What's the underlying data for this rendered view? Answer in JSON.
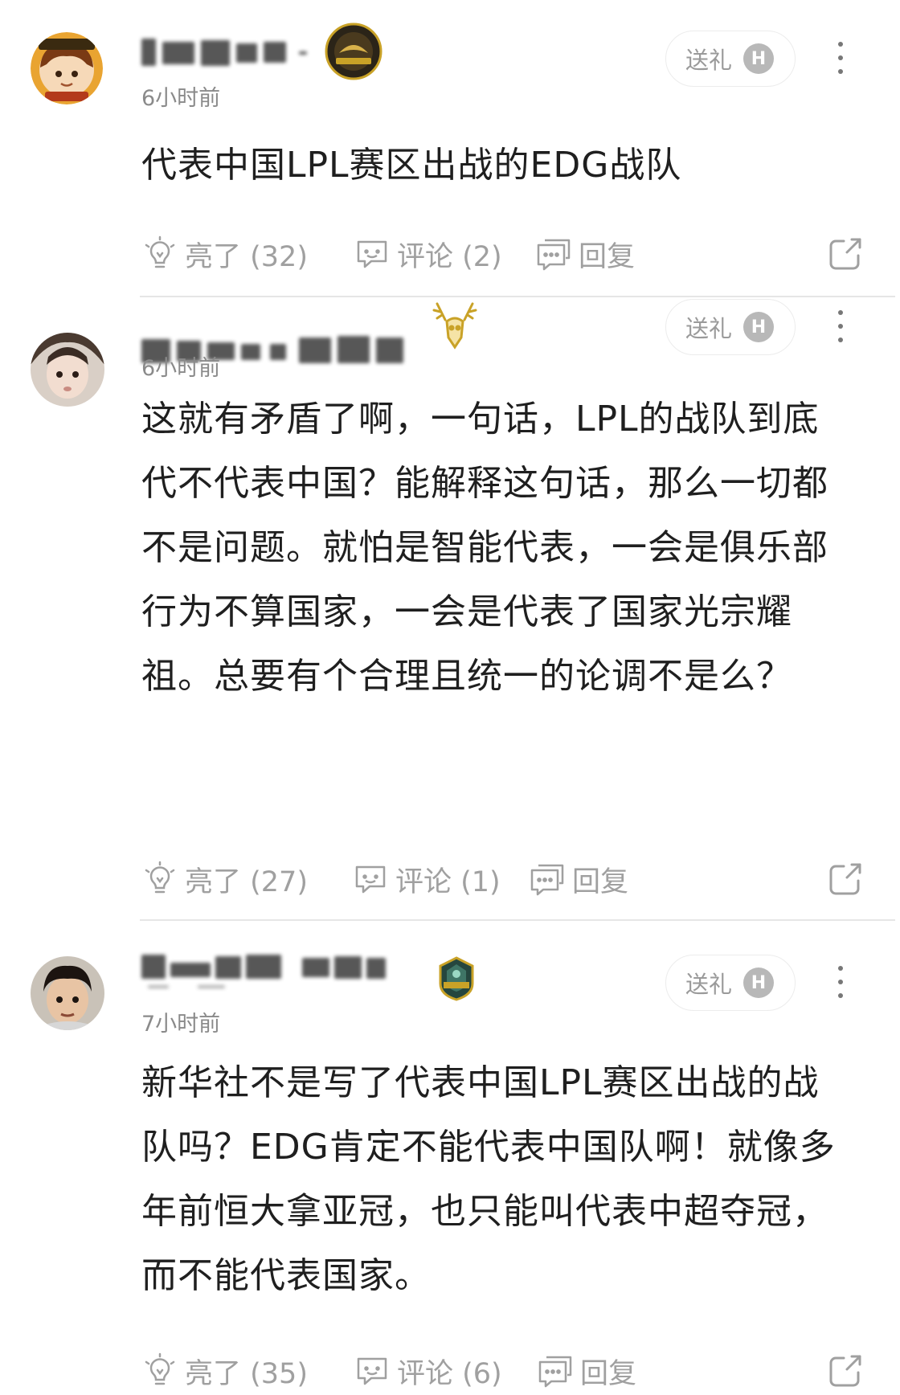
{
  "comments": [
    {
      "timestamp": "6小时前",
      "gift_label": "送礼",
      "gift_icon_letter": "H",
      "text": "代表中国LPL赛区出战的EDG战队",
      "actions": {
        "like": "亮了 (32)",
        "comment": "评论 (2)",
        "reply": "回复"
      },
      "icons": [
        "bulb-icon",
        "comment-icon",
        "reply-icon",
        "share-icon",
        "more-icon"
      ]
    },
    {
      "timestamp": "6小时前",
      "gift_label": "送礼",
      "gift_icon_letter": "H",
      "text": "这就有矛盾了啊，一句话，LPL的战队到底代不代表中国？能解释这句话，那么一切都不是问题。就怕是智能代表，一会是俱乐部行为不算国家，一会是代表了国家光宗耀祖。总要有个合理且统一的论调不是么？",
      "actions": {
        "like": "亮了 (27)",
        "comment": "评论 (1)",
        "reply": "回复"
      }
    },
    {
      "timestamp": "7小时前",
      "gift_label": "送礼",
      "gift_icon_letter": "H",
      "text": "新华社不是写了代表中国LPL赛区出战的战队吗？EDG肯定不能代表中国队啊！就像多年前恒大拿亚冠，也只能叫代表中超夺冠，而不能代表国家。",
      "actions": {
        "like": "亮了 (35)",
        "comment": "评论 (6)",
        "reply": "回复"
      }
    }
  ],
  "colors": {
    "muted": "#a0a0a0",
    "text": "#1f1f1f",
    "divider": "#e6e6e6",
    "badge_gold": "#c9a227"
  }
}
